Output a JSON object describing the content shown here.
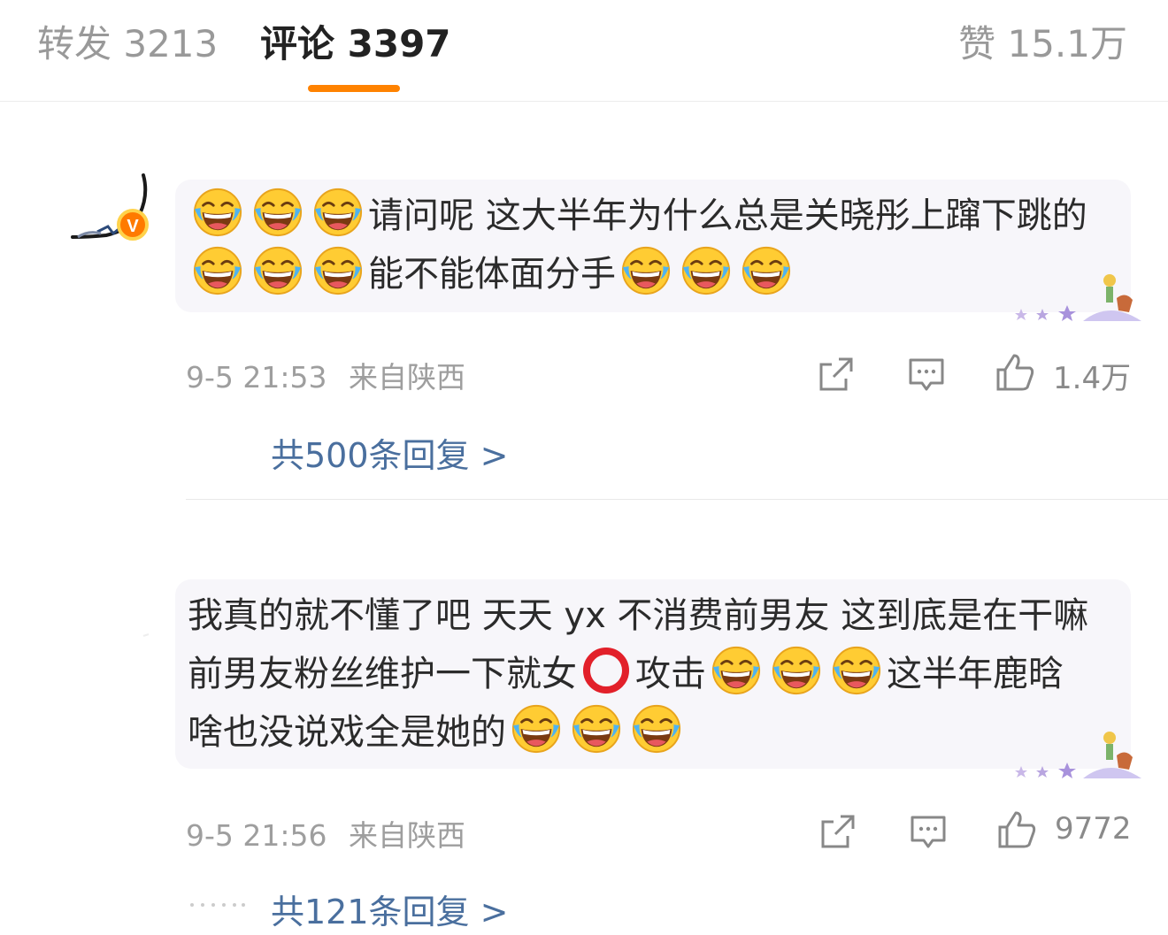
{
  "tabs": {
    "repost": "转发 3213",
    "comments": "评论 3397",
    "likes": "赞 15.1万"
  },
  "comments": [
    {
      "text_a": "请问呢 这大半年为什么总是关晓彤上蹿下跳的",
      "text_b": "能不能体面分手",
      "time": "9-5 21:53",
      "location": "来自陕西",
      "likes": "1.4万",
      "replies": "共500条回复 >"
    },
    {
      "text_a": "我真的就不懂了吧 天天 yx 不消费前男友 这到底是在干嘛 前男友粉丝维护一下就女",
      "text_b": "攻击",
      "text_c": "这半年鹿晗啥也没说戏全是她的",
      "time": "9-5 21:56",
      "location": "来自陕西",
      "likes": "9772",
      "replies": "共121条回复 >"
    }
  ],
  "icons": {
    "emoji": "laughing-tears-emoji",
    "share": "share-icon",
    "comment": "comment-icon",
    "like": "thumbs-up-icon",
    "verified": "verified-v-badge",
    "circle": "heavy-circle-emoji"
  },
  "colors": {
    "accent": "#ff8200",
    "link": "#4a6f9e",
    "muted": "#9e9e9e",
    "bubble": "#f7f6fa"
  }
}
